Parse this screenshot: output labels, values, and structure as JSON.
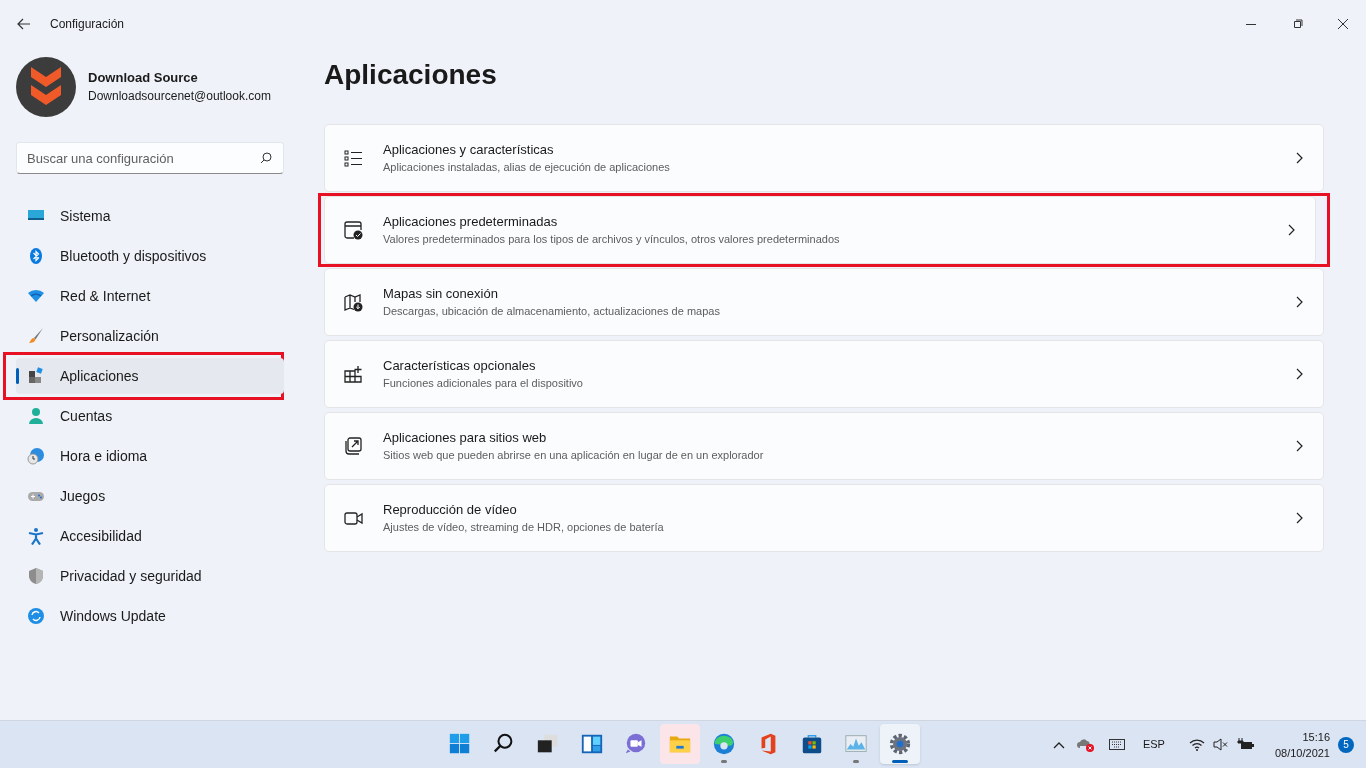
{
  "window": {
    "title": "Configuración"
  },
  "account": {
    "name": "Download Source",
    "email": "Downloadsourcenet@outlook.com"
  },
  "search": {
    "placeholder": "Buscar una configuración"
  },
  "sidebar": {
    "items": [
      {
        "kind": "system",
        "label": "Sistema",
        "selected": false,
        "highlighted": false
      },
      {
        "kind": "bluetooth",
        "label": "Bluetooth y dispositivos",
        "selected": false,
        "highlighted": false
      },
      {
        "kind": "network",
        "label": "Red & Internet",
        "selected": false,
        "highlighted": false
      },
      {
        "kind": "brush",
        "label": "Personalización",
        "selected": false,
        "highlighted": false
      },
      {
        "kind": "apps",
        "label": "Aplicaciones",
        "selected": true,
        "highlighted": true
      },
      {
        "kind": "accounts",
        "label": "Cuentas",
        "selected": false,
        "highlighted": false
      },
      {
        "kind": "time",
        "label": "Hora e idioma",
        "selected": false,
        "highlighted": false
      },
      {
        "kind": "games",
        "label": "Juegos",
        "selected": false,
        "highlighted": false
      },
      {
        "kind": "accessibility",
        "label": "Accesibilidad",
        "selected": false,
        "highlighted": false
      },
      {
        "kind": "privacy",
        "label": "Privacidad y seguridad",
        "selected": false,
        "highlighted": false
      },
      {
        "kind": "update",
        "label": "Windows Update",
        "selected": false,
        "highlighted": false
      }
    ]
  },
  "page": {
    "title": "Aplicaciones",
    "cards": [
      {
        "kind": "list",
        "title": "Aplicaciones y características",
        "description": "Aplicaciones instaladas, alias de ejecución de aplicaciones",
        "highlighted": false
      },
      {
        "kind": "default",
        "title": "Aplicaciones predeterminadas",
        "description": "Valores predeterminados para los tipos de archivos y vínculos, otros valores predeterminados",
        "highlighted": true
      },
      {
        "kind": "map",
        "title": "Mapas sin conexión",
        "description": "Descargas, ubicación de almacenamiento, actualizaciones de mapas",
        "highlighted": false
      },
      {
        "kind": "grid",
        "title": "Características opcionales",
        "description": "Funciones adicionales para el dispositivo",
        "highlighted": false
      },
      {
        "kind": "web",
        "title": "Aplicaciones para sitios web",
        "description": "Sitios web que pueden abrirse en una aplicación en lugar de en un explorador",
        "highlighted": false
      },
      {
        "kind": "video",
        "title": "Reproducción de vídeo",
        "description": "Ajustes de vídeo, streaming de HDR, opciones de batería",
        "highlighted": false
      }
    ]
  },
  "taskbar": {
    "apps": [
      {
        "kind": "start",
        "running": false,
        "selected": false,
        "hovered": false
      },
      {
        "kind": "search",
        "running": false,
        "selected": false,
        "hovered": false
      },
      {
        "kind": "taskview",
        "running": false,
        "selected": false,
        "hovered": false
      },
      {
        "kind": "widgets",
        "running": false,
        "selected": false,
        "hovered": false
      },
      {
        "kind": "chat",
        "running": false,
        "selected": false,
        "hovered": false
      },
      {
        "kind": "folder",
        "running": false,
        "selected": false,
        "hovered": true
      },
      {
        "kind": "browser",
        "running": true,
        "selected": false,
        "hovered": false
      },
      {
        "kind": "office",
        "running": false,
        "selected": false,
        "hovered": false
      },
      {
        "kind": "store",
        "running": false,
        "selected": false,
        "hovered": false
      },
      {
        "kind": "monitor",
        "running": true,
        "selected": false,
        "hovered": false
      },
      {
        "kind": "settings",
        "running": true,
        "selected": true,
        "hovered": false
      }
    ],
    "language": "ESP",
    "time": "15:16",
    "date": "08/10/2021",
    "notifications": "5"
  }
}
